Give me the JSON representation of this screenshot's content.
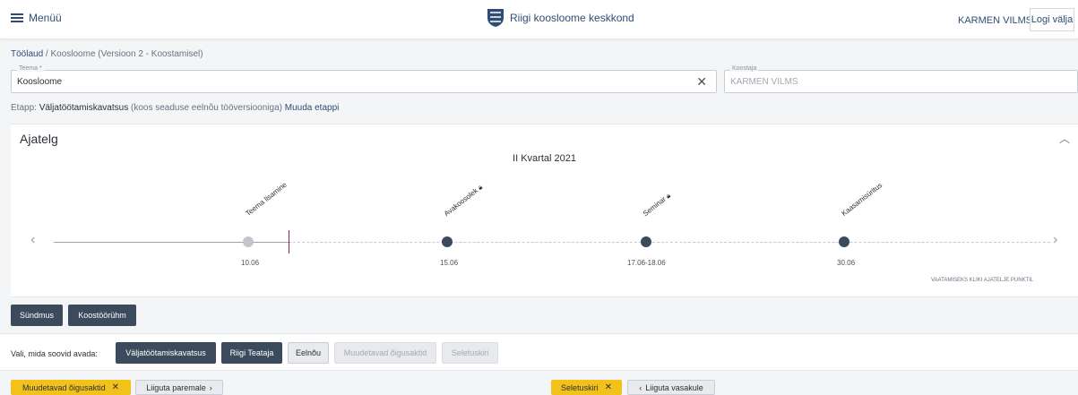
{
  "header": {
    "menu_label": "Menüü",
    "brand_title": "Riigi koosloome keskkond",
    "user_name": "KARMEN VILMS",
    "logout_label": "Logi välja"
  },
  "breadcrumb": {
    "home": "Töölaud",
    "separator": "/",
    "current": "Koosloome",
    "version": "(Versioon 2 - Koostamisel)"
  },
  "fields": {
    "topic": {
      "label": "Teema *",
      "value": "Koosloome"
    },
    "compiler": {
      "label": "Koostaja",
      "value": "KARMEN VILMS"
    }
  },
  "stage": {
    "prefix": "Etapp:",
    "name": "Väljatöötamiskavatsus",
    "note": "(koos seaduse eelnõu tööversiooniga)",
    "change_link": "Muuda etappi"
  },
  "timeline": {
    "title": "Ajatelg",
    "collapse_icon": "chevron-up-icon",
    "quarter": "II Kvartal 2021",
    "events": [
      {
        "label": "Teema lisamine",
        "date": "10.06",
        "status": "done",
        "locked": false
      },
      {
        "label": "Avakoosolek",
        "date": "15.06",
        "status": "future",
        "locked": true
      },
      {
        "label": "Seminar",
        "date": "17.06-18.06",
        "status": "future",
        "locked": true
      },
      {
        "label": "Kaasamisüritus",
        "date": "30.06",
        "status": "future",
        "locked": false
      }
    ],
    "hint": "VAATAMISEKS KLIKI AJATELJE PUNKTIL",
    "colors": {
      "today_marker": "#8e1f5a",
      "done_dot": "#c2c6cc",
      "future_dot": "#3b4b5d"
    }
  },
  "timeline_actions": {
    "event": "Sündmus",
    "workgroup": "Koostöörühm"
  },
  "open_panel": {
    "label": "Vali, mida soovid avada:",
    "buttons": [
      {
        "label": "Väljatöötamiskavatsus",
        "state": "active"
      },
      {
        "label": "Riigi Teataja",
        "state": "active"
      },
      {
        "label": "Eelnõu",
        "state": "light"
      },
      {
        "label": "Muudetavad õigusaktid",
        "state": "disabled"
      },
      {
        "label": "Seletuskiri",
        "state": "disabled"
      }
    ]
  },
  "bottom_bar": {
    "left_tab": "Muudetavad õigusaktid",
    "move_right": "Liiguta paremale",
    "right_tab": "Seletuskiri",
    "move_left": "Liiguta vasakule",
    "accent": "#f2c21a"
  }
}
